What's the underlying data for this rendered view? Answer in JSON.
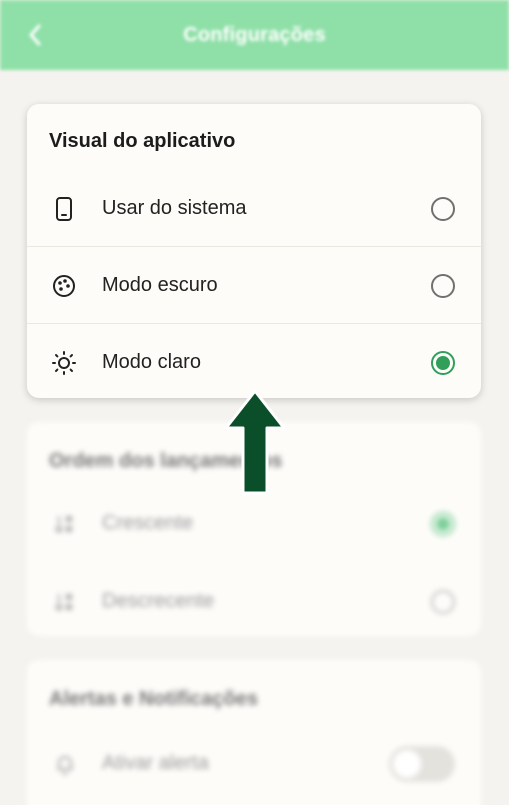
{
  "header": {
    "title": "Configurações",
    "back_icon": "chevron-left-icon",
    "color": "#8fe0a8"
  },
  "visual_section": {
    "title": "Visual do aplicativo",
    "options": [
      {
        "label": "Usar do sistema",
        "icon": "phone-icon",
        "selected": false
      },
      {
        "label": "Modo escuro",
        "icon": "palette-icon",
        "selected": false
      },
      {
        "label": "Modo claro",
        "icon": "sun-icon",
        "selected": true
      }
    ]
  },
  "order_section": {
    "title": "Ordem dos lançamentos",
    "options": [
      {
        "label": "Crescente",
        "icon": "sort-ascending-icon",
        "selected": true
      },
      {
        "label": "Descrecente",
        "icon": "sort-descending-icon",
        "selected": false
      }
    ]
  },
  "alerts_section": {
    "title": "Alertas e Notificações",
    "items": [
      {
        "label": "Ativar alerta",
        "icon": "bell-icon",
        "enabled": false
      }
    ]
  },
  "accent_color": "#2f9f5a",
  "annotation": {
    "icon": "up-arrow-icon",
    "color": "#0b4f2a"
  }
}
